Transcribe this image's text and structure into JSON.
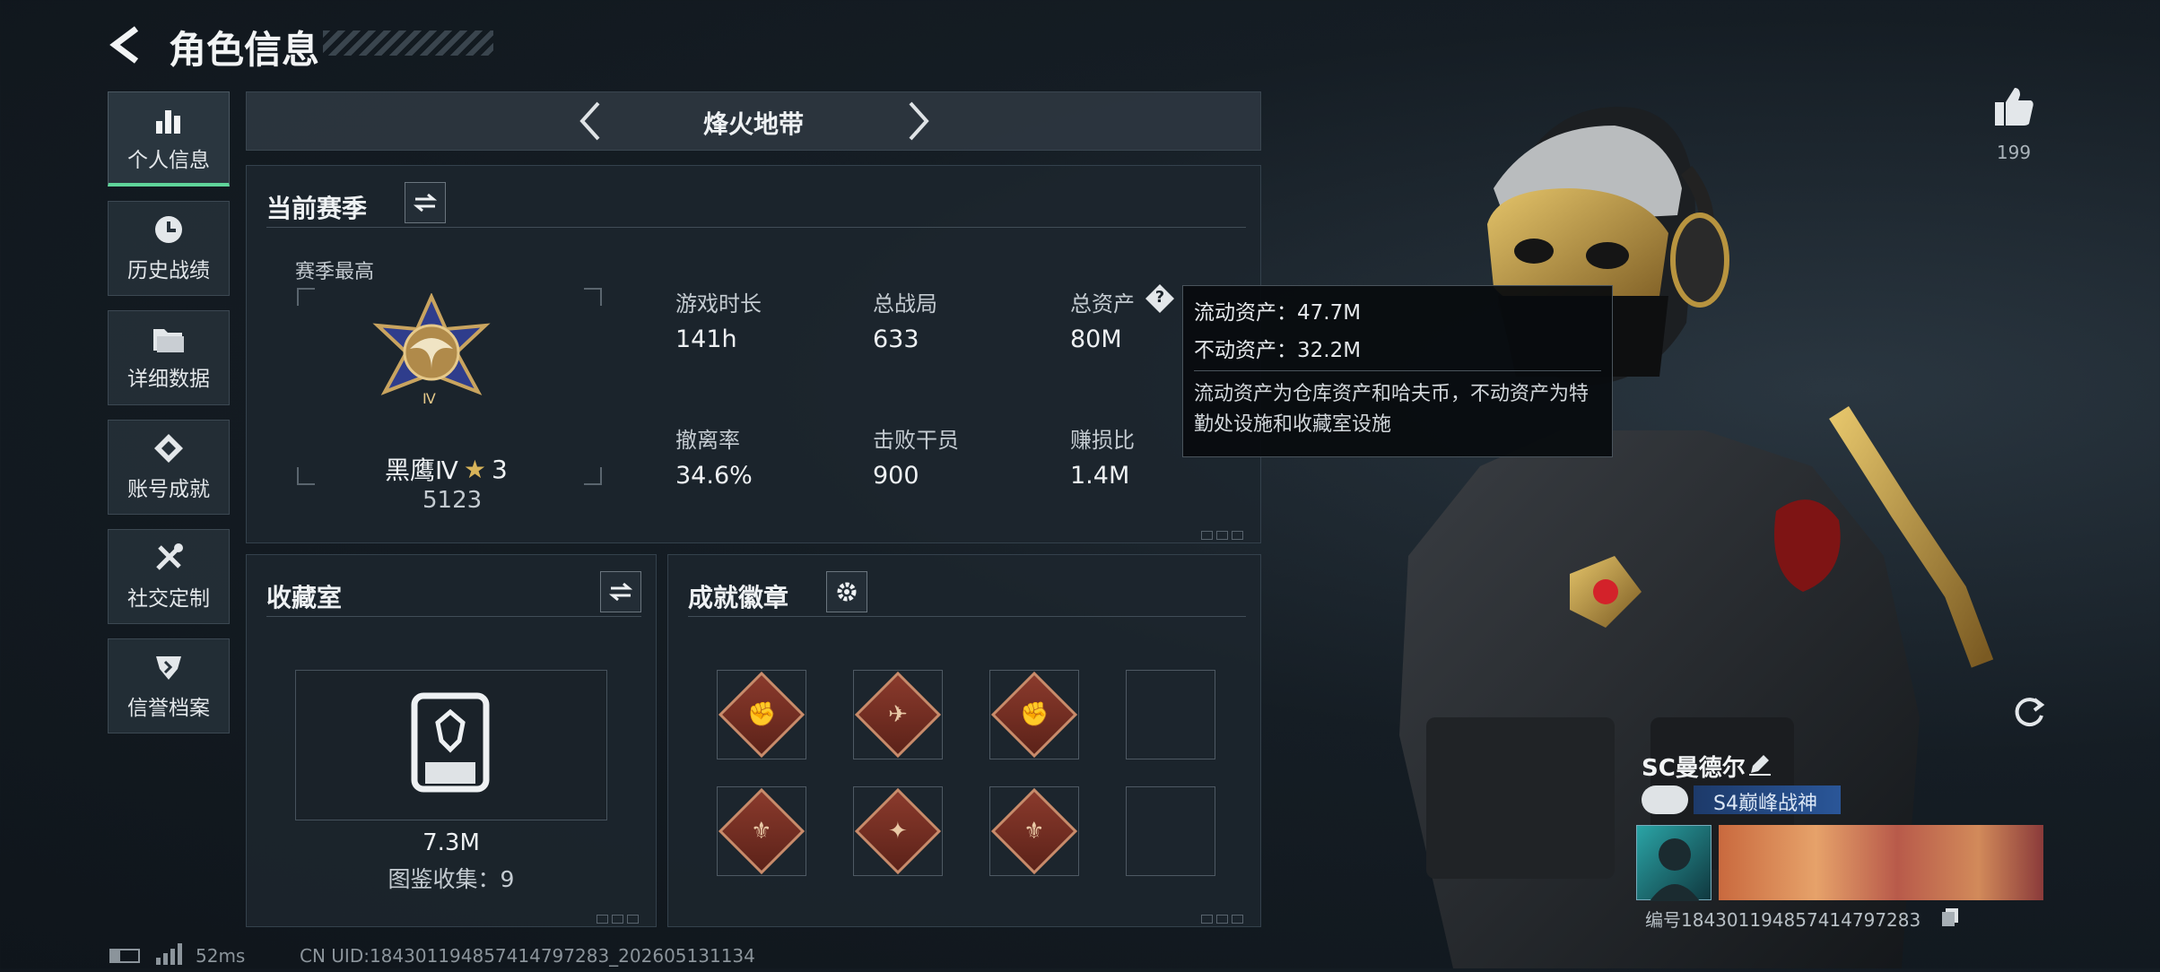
{
  "header": {
    "title": "角色信息"
  },
  "sidebar": {
    "items": [
      {
        "label": "个人信息",
        "icon": "bar-chart-icon"
      },
      {
        "label": "历史战绩",
        "icon": "clock-icon"
      },
      {
        "label": "详细数据",
        "icon": "folder-icon"
      },
      {
        "label": "账号成就",
        "icon": "achievement-icon"
      },
      {
        "label": "社交定制",
        "icon": "tools-icon"
      },
      {
        "label": "信誉档案",
        "icon": "shield-icon"
      }
    ]
  },
  "mode_selector": {
    "label": "烽火地带"
  },
  "season": {
    "title": "当前赛季",
    "best_label": "赛季最高",
    "rank_name": "黑鹰Ⅳ",
    "rank_stars": "3",
    "rank_score": "5123",
    "rank_emblem_text": "Ⅳ",
    "stats": [
      {
        "label": "游戏时长",
        "value": "141h"
      },
      {
        "label": "总战局",
        "value": "633"
      },
      {
        "label": "总资产",
        "value": "80M"
      },
      {
        "label": "撤离率",
        "value": "34.6%"
      },
      {
        "label": "击败干员",
        "value": "900"
      },
      {
        "label": "赚损比",
        "value": "1.4M"
      }
    ],
    "help_glyph": "?"
  },
  "tooltip": {
    "liquid": "流动资产：47.7M",
    "fixed": "不动资产：32.2M",
    "desc": "流动资产为仓库资产和哈夫币，不动资产为特勤处设施和收藏室设施"
  },
  "collection": {
    "title": "收藏室",
    "value": "7.3M",
    "codex": "图鉴收集：9"
  },
  "achievements": {
    "title": "成就徽章",
    "badges": [
      "✊",
      "✈",
      "✊",
      "",
      "⚜",
      "✦",
      "⚜",
      ""
    ]
  },
  "likes": {
    "count": "199"
  },
  "profile": {
    "name": "SC曼德尔",
    "title_badge": "S4巅峰战神",
    "id_line": "编号1843011948574147972​83"
  },
  "footer": {
    "ping": "52ms",
    "uid": "CN UID:184301194857414797283_202605131134"
  },
  "colors": {
    "accent": "#5fd49a",
    "badge_gold": "#c98b6a"
  }
}
